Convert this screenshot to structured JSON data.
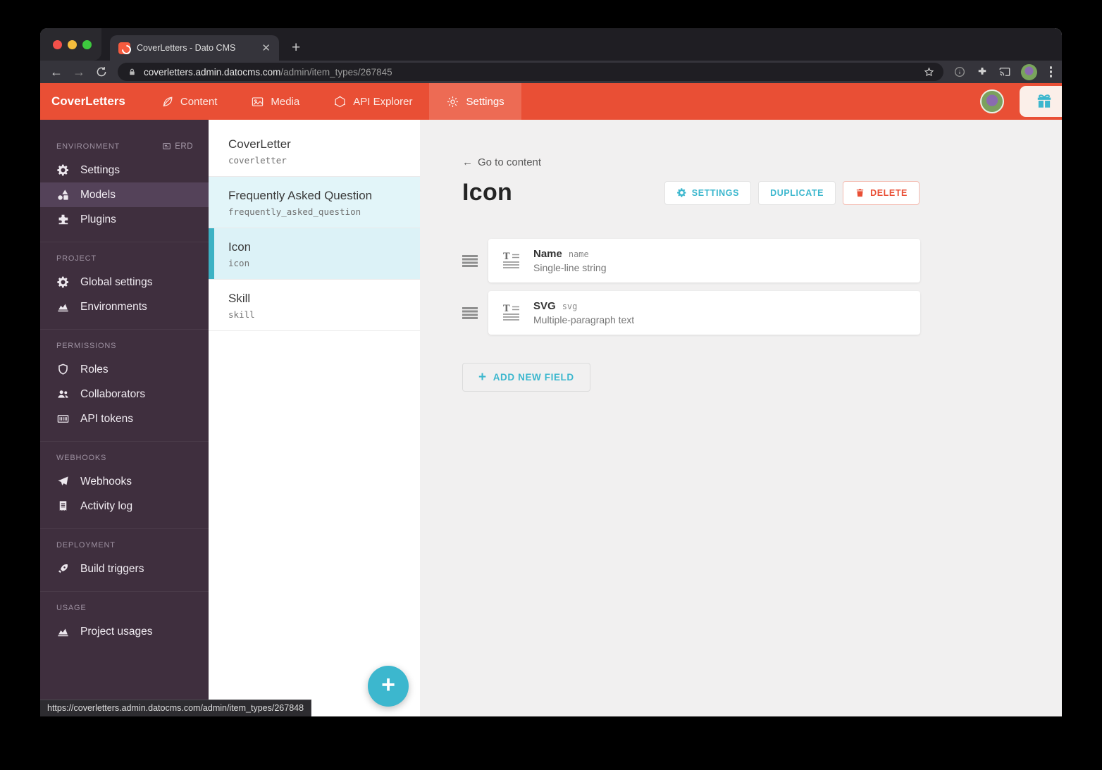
{
  "browser": {
    "tab_title": "CoverLetters - Dato CMS",
    "url_host": "coverletters.admin.datocms.com",
    "url_path": "/admin/item_types/267845",
    "status_tooltip": "https://coverletters.admin.datocms.com/admin/item_types/267848"
  },
  "nav": {
    "brand": "CoverLetters",
    "items": [
      {
        "label": "Content"
      },
      {
        "label": "Media"
      },
      {
        "label": "API Explorer"
      },
      {
        "label": "Settings",
        "active": true
      }
    ]
  },
  "sidebar": {
    "sections": [
      {
        "label": "ENVIRONMENT",
        "badge": "ERD",
        "items": [
          {
            "label": "Settings"
          },
          {
            "label": "Models",
            "active": true
          },
          {
            "label": "Plugins"
          }
        ]
      },
      {
        "label": "PROJECT",
        "items": [
          {
            "label": "Global settings"
          },
          {
            "label": "Environments"
          }
        ]
      },
      {
        "label": "PERMISSIONS",
        "items": [
          {
            "label": "Roles"
          },
          {
            "label": "Collaborators"
          },
          {
            "label": "API tokens"
          }
        ]
      },
      {
        "label": "WEBHOOKS",
        "items": [
          {
            "label": "Webhooks"
          },
          {
            "label": "Activity log"
          }
        ]
      },
      {
        "label": "DEPLOYMENT",
        "items": [
          {
            "label": "Build triggers"
          }
        ]
      },
      {
        "label": "USAGE",
        "items": [
          {
            "label": "Project usages"
          }
        ]
      }
    ]
  },
  "models_panel": {
    "items": [
      {
        "name": "CoverLetter",
        "api_key": "coverletter",
        "state": "normal"
      },
      {
        "name": "Frequently Asked Question",
        "api_key": "frequently_asked_question",
        "state": "hover"
      },
      {
        "name": "Icon",
        "api_key": "icon",
        "state": "selected"
      },
      {
        "name": "Skill",
        "api_key": "skill",
        "state": "normal"
      }
    ],
    "add_button": "+"
  },
  "main": {
    "back_arrow": "←",
    "back_label": "Go to content",
    "title": "Icon",
    "actions": {
      "settings": "SETTINGS",
      "duplicate": "DUPLICATE",
      "delete": "DELETE"
    },
    "fields": [
      {
        "name": "Name",
        "api_key": "name",
        "type": "Single-line string"
      },
      {
        "name": "SVG",
        "api_key": "svg",
        "type": "Multiple-paragraph text"
      }
    ],
    "add_field_plus": "+",
    "add_field_label": "ADD NEW FIELD"
  },
  "colors": {
    "nav_red": "#E94F35",
    "nav_active": "#ED6B54",
    "sidebar_purple": "#3F2F3E",
    "accent_teal": "#3CB7CE",
    "selected_row": "#DCF2F7",
    "delete_red": "#E94F35"
  }
}
